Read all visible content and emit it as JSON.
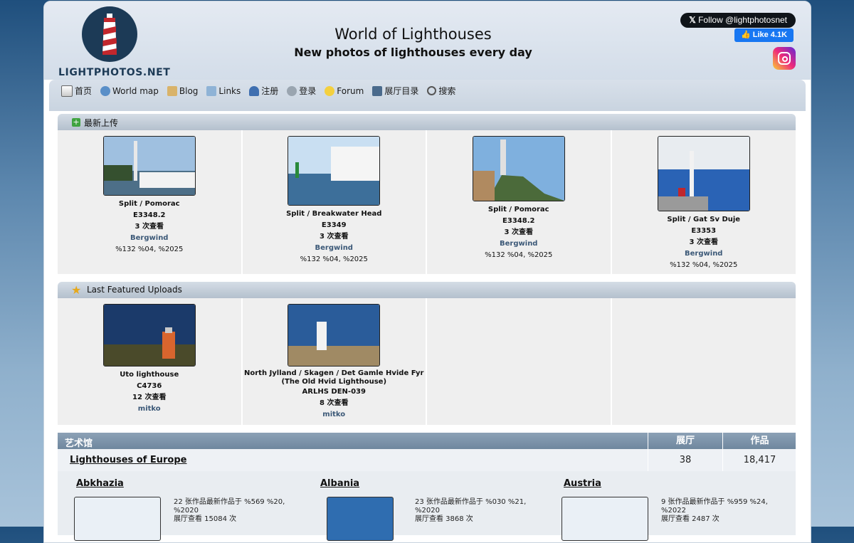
{
  "header": {
    "logo_text": "LIGHTPHOTOS.NET",
    "title": "World of Lighthouses",
    "subtitle": "New photos of lighthouses every day",
    "twitter_label": "Follow @lightphotosnet",
    "like_label": "Like 4.1K"
  },
  "nav": [
    {
      "label": "首页",
      "icon": "home-icon"
    },
    {
      "label": "World map",
      "icon": "globe-icon"
    },
    {
      "label": "Blog",
      "icon": "blog-icon"
    },
    {
      "label": "Links",
      "icon": "links-icon"
    },
    {
      "label": "注册",
      "icon": "register-icon"
    },
    {
      "label": "登录",
      "icon": "login-icon"
    },
    {
      "label": "Forum",
      "icon": "bulb-icon"
    },
    {
      "label": "展厅目录",
      "icon": "gallery-icon"
    },
    {
      "label": "搜索",
      "icon": "search-icon"
    }
  ],
  "latest": {
    "title": "最新上传",
    "items": [
      {
        "title": "Split / Pomorac",
        "code": "E3348.2",
        "views": "3 次查看",
        "owner": "Bergwind",
        "date": "%132 %04, %2025"
      },
      {
        "title": "Split / Breakwater Head",
        "code": "E3349",
        "views": "3 次查看",
        "owner": "Bergwind",
        "date": "%132 %04, %2025"
      },
      {
        "title": "Split / Pomorac",
        "code": "E3348.2",
        "views": "3 次查看",
        "owner": "Bergwind",
        "date": "%132 %04, %2025"
      },
      {
        "title": "Split / Gat Sv Duje",
        "code": "E3353",
        "views": "3 次查看",
        "owner": "Bergwind",
        "date": "%132 %04, %2025"
      }
    ]
  },
  "featured": {
    "title": "Last Featured Uploads",
    "items": [
      {
        "title": "Uto lighthouse",
        "code": "C4736",
        "views": "12 次查看",
        "owner": "mitko"
      },
      {
        "title": "North Jylland / Skagen / Det Gamle Hvide Fyr (The Old Hvid Lighthouse)",
        "code": "ARLHS DEN-039",
        "views": "8 次查看",
        "owner": "mitko"
      }
    ]
  },
  "gallery": {
    "col_gallery": "艺术馆",
    "col_albums": "展厅",
    "col_works": "作品",
    "row_name": "Lighthouses of Europe",
    "row_albums": "38",
    "row_works": "18,417",
    "countries": [
      {
        "name": "Abkhazia",
        "line1": "22 张作品最新作品于 %569 %20, %2020",
        "line2": "展厅查看 15084 次"
      },
      {
        "name": "Albania",
        "line1": "23 张作品最新作品于 %030 %21, %2020",
        "line2": "展厅查看 3868 次"
      },
      {
        "name": "Austria",
        "line1": "9 张作品最新作品于 %959 %24, %2022",
        "line2": "展厅查看 2487 次"
      }
    ]
  }
}
